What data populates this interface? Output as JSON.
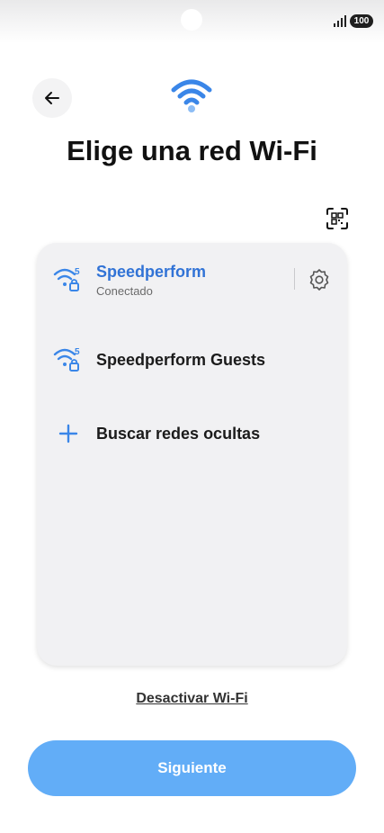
{
  "status_bar": {
    "battery": "100",
    "signal_icon": "signal-bars-icon"
  },
  "header": {
    "back_icon": "arrow-left-icon",
    "wifi_icon": "wifi-icon",
    "title": "Elige una red Wi-Fi",
    "qr_icon": "qr-scan-icon"
  },
  "networks": [
    {
      "name": "Speedperform",
      "status": "Conectado",
      "icon": "wifi-5ghz-lock-icon",
      "band": "5",
      "connected": true,
      "settings_icon": "gear-icon"
    },
    {
      "name": "Speedperform Guests",
      "icon": "wifi-5ghz-lock-icon",
      "band": "5",
      "connected": false
    }
  ],
  "hidden_networks": {
    "label": "Buscar redes ocultas",
    "icon": "plus-icon"
  },
  "footer": {
    "disable_wifi": "Desactivar Wi-Fi",
    "next_label": "Siguiente"
  },
  "colors": {
    "accent": "#3173d6",
    "wifi_blue": "#3a86e8",
    "button": "#62adf7",
    "card": "#f1f1f3"
  }
}
